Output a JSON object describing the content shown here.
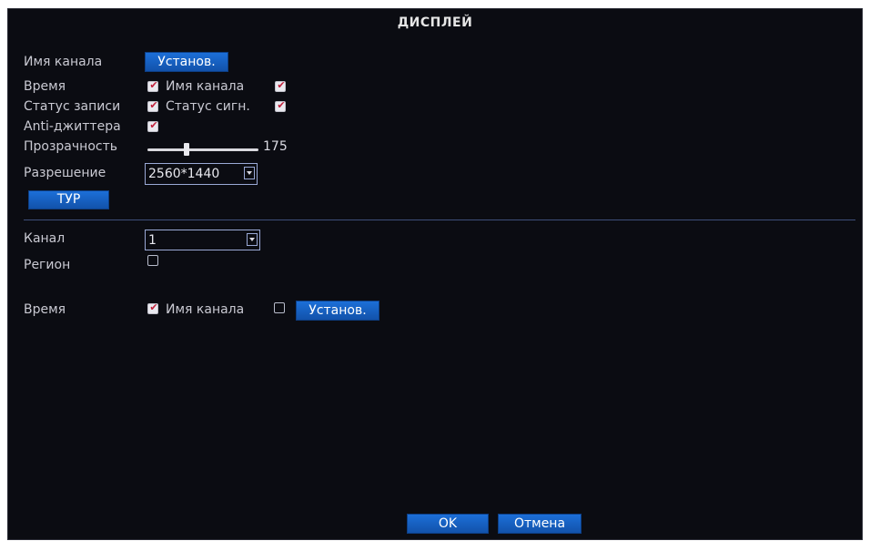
{
  "window": {
    "title": "ДИСПЛЕЙ"
  },
  "top": {
    "channel_name_label": "Имя канала",
    "channel_name_btn": "Установ.",
    "time_label": "Время",
    "time_checked": true,
    "channel_name_check_label": "Имя канала",
    "channel_name_checked": true,
    "rec_status_label": "Статус записи",
    "rec_status_checked": true,
    "alarm_status_label": "Статус сигн.",
    "alarm_status_checked": true,
    "antijitter_label": "Anti-джиттера",
    "antijitter_checked": true,
    "transparency_label": "Прозрачность",
    "transparency_value": "175",
    "resolution_label": "Разрешение",
    "resolution_value": "2560*1440",
    "tour_btn": "ТУР"
  },
  "bottom": {
    "channel_label": "Канал",
    "channel_value": "1",
    "region_label": "Регион",
    "region_checked": false,
    "time_label": "Время",
    "time_checked": true,
    "channel_name_label": "Имя канала",
    "channel_name_checked": false,
    "set_btn": "Установ."
  },
  "footer": {
    "ok": "OK",
    "cancel": "Отмена"
  }
}
